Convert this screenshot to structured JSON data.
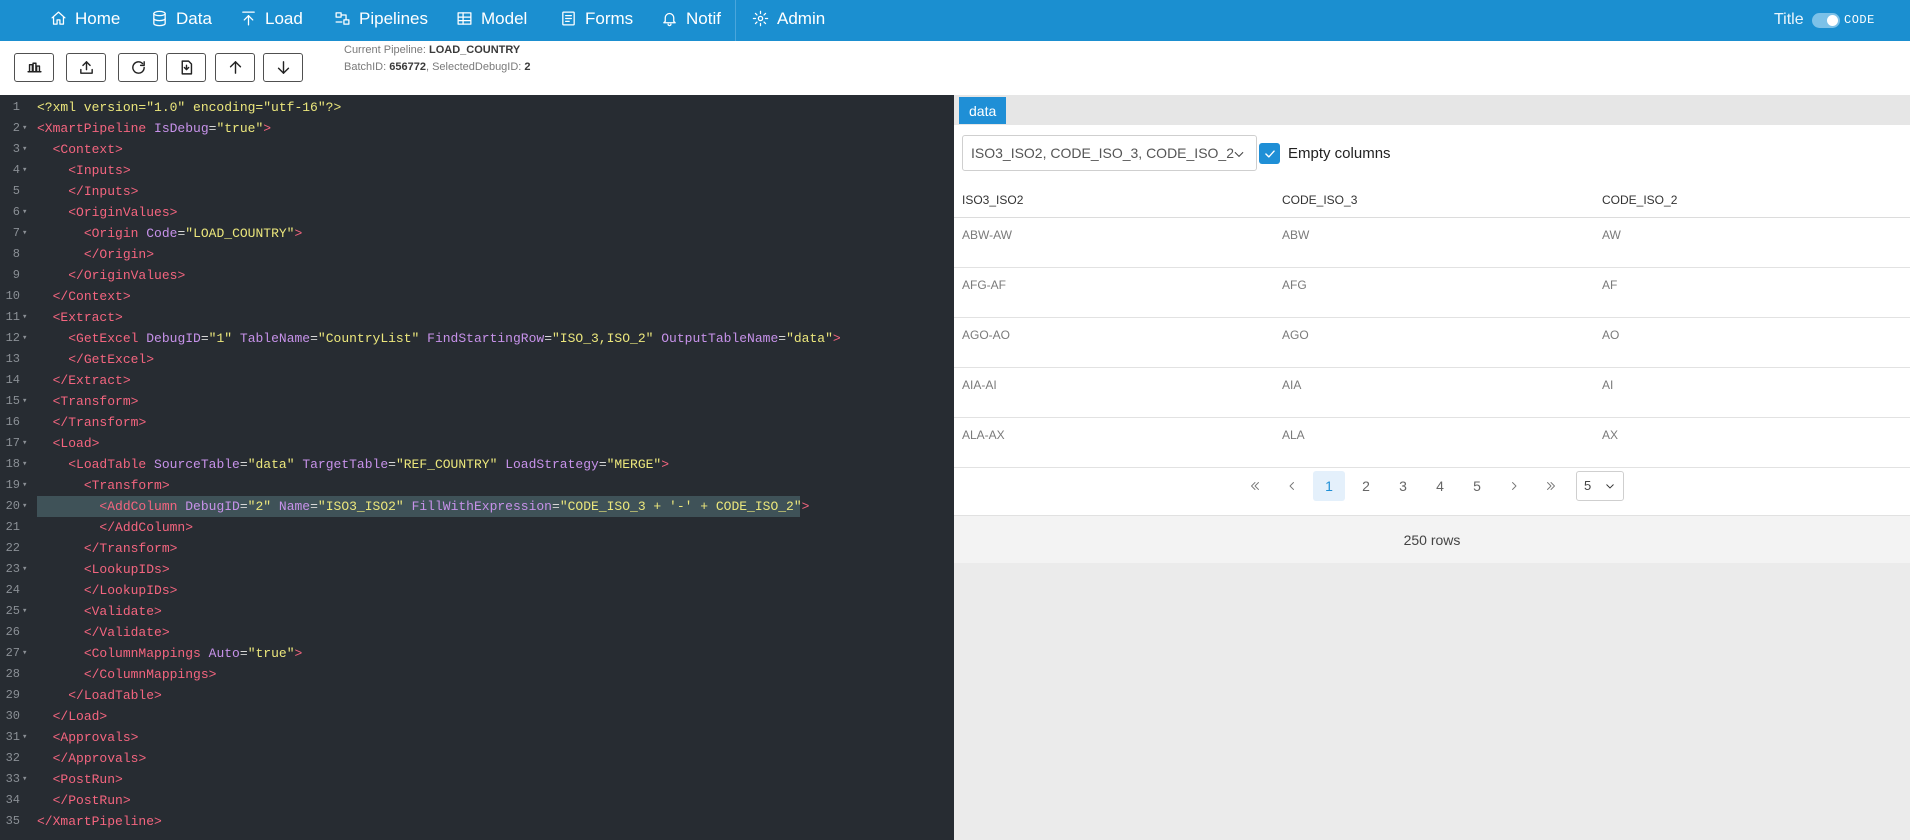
{
  "nav": {
    "items": [
      {
        "label": "Home",
        "icon": "home-icon"
      },
      {
        "label": "Data",
        "icon": "database-icon"
      },
      {
        "label": "Load",
        "icon": "upload-arrow-icon"
      },
      {
        "label": "Pipelines",
        "icon": "pipeline-icon"
      },
      {
        "label": "Model",
        "icon": "table-icon"
      },
      {
        "label": "Forms",
        "icon": "form-icon"
      },
      {
        "label": "Notif",
        "icon": "bell-icon"
      },
      {
        "label": "Admin",
        "icon": "gear-icon"
      }
    ],
    "title_label": "Title",
    "toggle_label": "CODE",
    "toggle_on": true
  },
  "toolbar": {
    "buttons": [
      "save-pipeline-icon",
      "upload-icon",
      "refresh-icon",
      "export-file-icon",
      "arrow-up-icon",
      "arrow-down-icon"
    ],
    "pipeline_label": "Current Pipeline: ",
    "pipeline_value": "LOAD_COUNTRY",
    "batch_label": "BatchID: ",
    "batch_value": "656772",
    "debug_label": ", SelectedDebugID: ",
    "debug_value": "2"
  },
  "editor": {
    "highlighted_line": 20,
    "lines": [
      {
        "n": "1",
        "fold": false,
        "text": "<?xml version=\"1.0\" encoding=\"utf-16\"?>"
      },
      {
        "n": "2",
        "fold": true,
        "text": "<XmartPipeline IsDebug=\"true\">"
      },
      {
        "n": "3",
        "fold": true,
        "text": "  <Context>"
      },
      {
        "n": "4",
        "fold": true,
        "text": "    <Inputs>"
      },
      {
        "n": "5",
        "fold": false,
        "text": "    </Inputs>"
      },
      {
        "n": "6",
        "fold": true,
        "text": "    <OriginValues>"
      },
      {
        "n": "7",
        "fold": true,
        "text": "      <Origin Code=\"LOAD_COUNTRY\">"
      },
      {
        "n": "8",
        "fold": false,
        "text": "      </Origin>"
      },
      {
        "n": "9",
        "fold": false,
        "text": "    </OriginValues>"
      },
      {
        "n": "10",
        "fold": false,
        "text": "  </Context>"
      },
      {
        "n": "11",
        "fold": true,
        "text": "  <Extract>"
      },
      {
        "n": "12",
        "fold": true,
        "text": "    <GetExcel DebugID=\"1\" TableName=\"CountryList\" FindStartingRow=\"ISO_3,ISO_2\" OutputTableName=\"data\">"
      },
      {
        "n": "13",
        "fold": false,
        "text": "    </GetExcel>"
      },
      {
        "n": "14",
        "fold": false,
        "text": "  </Extract>"
      },
      {
        "n": "15",
        "fold": true,
        "text": "  <Transform>"
      },
      {
        "n": "16",
        "fold": false,
        "text": "  </Transform>"
      },
      {
        "n": "17",
        "fold": true,
        "text": "  <Load>"
      },
      {
        "n": "18",
        "fold": true,
        "text": "    <LoadTable SourceTable=\"data\" TargetTable=\"REF_COUNTRY\" LoadStrategy=\"MERGE\">"
      },
      {
        "n": "19",
        "fold": true,
        "text": "      <Transform>"
      },
      {
        "n": "20",
        "fold": true,
        "text": "        <AddColumn DebugID=\"2\" Name=\"ISO3_ISO2\" FillWithExpression=\"CODE_ISO_3 + '-' + CODE_ISO_2\">"
      },
      {
        "n": "21",
        "fold": false,
        "text": "        </AddColumn>"
      },
      {
        "n": "22",
        "fold": false,
        "text": "      </Transform>"
      },
      {
        "n": "23",
        "fold": true,
        "text": "      <LookupIDs>"
      },
      {
        "n": "24",
        "fold": false,
        "text": "      </LookupIDs>"
      },
      {
        "n": "25",
        "fold": true,
        "text": "      <Validate>"
      },
      {
        "n": "26",
        "fold": false,
        "text": "      </Validate>"
      },
      {
        "n": "27",
        "fold": true,
        "text": "      <ColumnMappings Auto=\"true\">"
      },
      {
        "n": "28",
        "fold": false,
        "text": "      </ColumnMappings>"
      },
      {
        "n": "29",
        "fold": false,
        "text": "    </LoadTable>"
      },
      {
        "n": "30",
        "fold": false,
        "text": "  </Load>"
      },
      {
        "n": "31",
        "fold": true,
        "text": "  <Approvals>"
      },
      {
        "n": "32",
        "fold": false,
        "text": "  </Approvals>"
      },
      {
        "n": "33",
        "fold": true,
        "text": "  <PostRun>"
      },
      {
        "n": "34",
        "fold": false,
        "text": "  </PostRun>"
      },
      {
        "n": "35",
        "fold": false,
        "text": "</XmartPipeline>"
      }
    ]
  },
  "results": {
    "tab_label": "data",
    "columns_select_value": "ISO3_ISO2, CODE_ISO_3, CODE_ISO_2",
    "empty_columns_label": "Empty columns",
    "empty_columns_checked": true,
    "headers": [
      "ISO3_ISO2",
      "CODE_ISO_3",
      "CODE_ISO_2"
    ],
    "rows": [
      [
        "ABW-AW",
        "ABW",
        "AW"
      ],
      [
        "AFG-AF",
        "AFG",
        "AF"
      ],
      [
        "AGO-AO",
        "AGO",
        "AO"
      ],
      [
        "AIA-AI",
        "AIA",
        "AI"
      ],
      [
        "ALA-AX",
        "ALA",
        "AX"
      ]
    ],
    "pages": [
      "1",
      "2",
      "3",
      "4",
      "5"
    ],
    "current_page": "1",
    "page_size": "5",
    "row_count_label": "250 rows"
  },
  "colors": {
    "nav_bg": "#1b8fd0",
    "accent": "#1f8fd6",
    "editor_bg": "#272c32",
    "xml_tag": "#f4657f",
    "xml_attr": "#c792ea",
    "xml_value": "#ece77c"
  }
}
